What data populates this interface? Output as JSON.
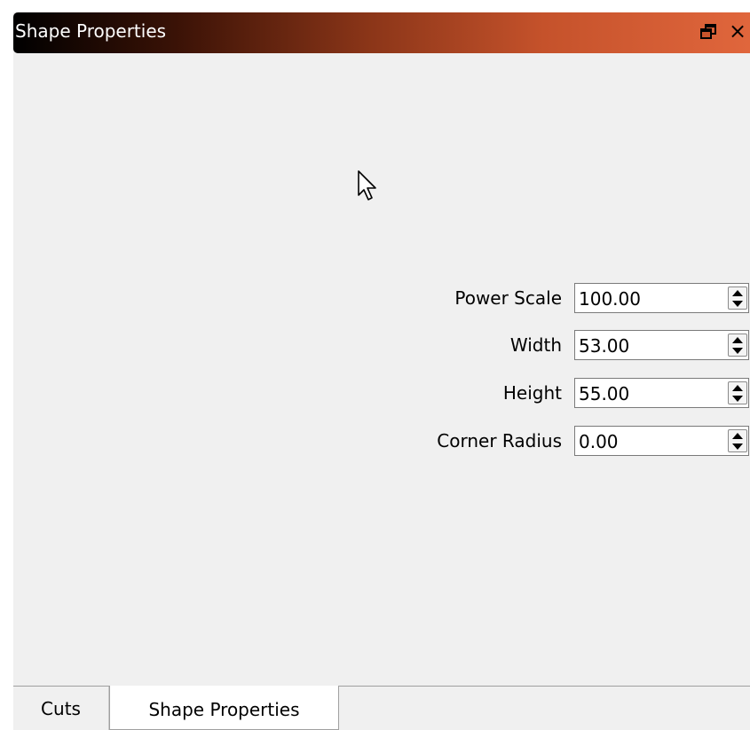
{
  "dock": {
    "title": "Shape Properties",
    "float_icon": "float-restore-icon",
    "close_label": "×"
  },
  "fields": [
    {
      "label": "Power Scale",
      "value": "100.00"
    },
    {
      "label": "Width",
      "value": "53.00"
    },
    {
      "label": "Height",
      "value": "55.00"
    },
    {
      "label": "Corner Radius",
      "value": "0.00"
    }
  ],
  "tabs": [
    {
      "label": "Cuts",
      "active": false
    },
    {
      "label": "Shape Properties",
      "active": true
    }
  ],
  "icons": {
    "cursor": "mouse-pointer-icon",
    "spin": "spin-up-down-icon"
  }
}
